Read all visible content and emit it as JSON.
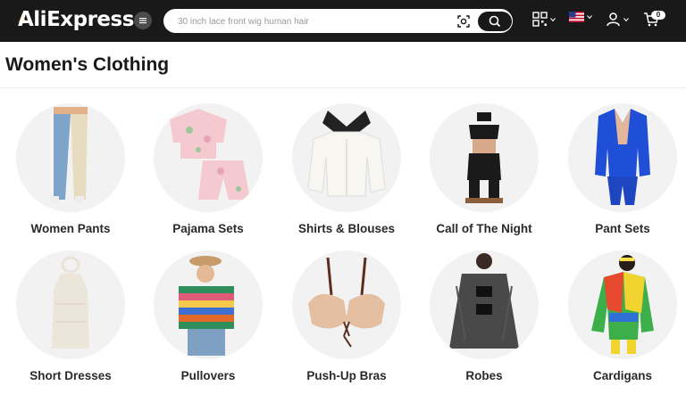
{
  "header": {
    "logo_text": "AliExpress",
    "search_placeholder": "30 inch lace front wig human hair",
    "cart_count": "0"
  },
  "page": {
    "title": "Women's Clothing"
  },
  "categories": [
    {
      "label": "Women Pants",
      "icon": "women-pants-image"
    },
    {
      "label": "Pajama Sets",
      "icon": "pajama-set-image"
    },
    {
      "label": "Shirts & Blouses",
      "icon": "blouse-image"
    },
    {
      "label": "Call of The Night",
      "icon": "lingerie-set-image"
    },
    {
      "label": "Pant Sets",
      "icon": "blue-suit-image"
    },
    {
      "label": "Short Dresses",
      "icon": "short-dress-image"
    },
    {
      "label": "Pullovers",
      "icon": "striped-pullover-image"
    },
    {
      "label": "Push-Up Bras",
      "icon": "push-up-bra-image"
    },
    {
      "label": "Robes",
      "icon": "lace-robe-image"
    },
    {
      "label": "Cardigans",
      "icon": "colorful-cardigan-image"
    }
  ],
  "colors": {
    "header_bg": "#191919",
    "circle_bg": "#f2f2f2",
    "accent": "#f5a623"
  }
}
